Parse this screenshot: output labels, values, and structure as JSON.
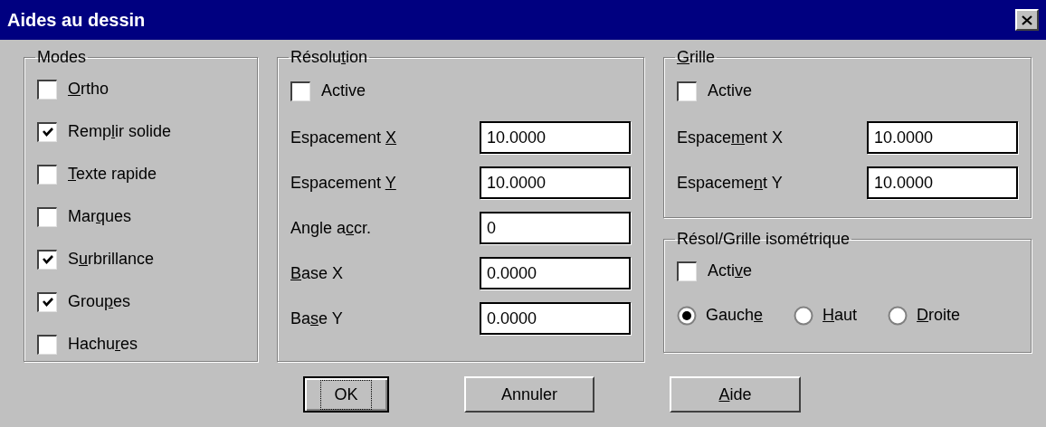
{
  "window": {
    "title": "Aides au dessin"
  },
  "groups": [
    {
      "kind": "checklist",
      "title": [
        {
          "text": "Modes"
        }
      ],
      "items": [
        {
          "label": [
            {
              "text": "O",
              "underlined": true
            },
            {
              "text": "rtho"
            }
          ],
          "checked": false
        },
        {
          "label": [
            {
              "text": "Remp"
            },
            {
              "text": "l",
              "underlined": true
            },
            {
              "text": "ir solide"
            }
          ],
          "checked": true
        },
        {
          "label": [
            {
              "text": "T",
              "underlined": true
            },
            {
              "text": "exte rapide"
            }
          ],
          "checked": false
        },
        {
          "label": [
            {
              "text": "Mar"
            },
            {
              "text": "q",
              "underlined": true
            },
            {
              "text": "ues"
            }
          ],
          "checked": false
        },
        {
          "label": [
            {
              "text": "S"
            },
            {
              "text": "u",
              "underlined": true
            },
            {
              "text": "rbrillance"
            }
          ],
          "checked": true
        },
        {
          "label": [
            {
              "text": "Grou"
            },
            {
              "text": "p",
              "underlined": true
            },
            {
              "text": "es"
            }
          ],
          "checked": true
        },
        {
          "label": [
            {
              "text": "Hachu"
            },
            {
              "text": "r",
              "underlined": true
            },
            {
              "text": "es"
            }
          ],
          "checked": false
        }
      ]
    },
    {
      "kind": "settings",
      "title": [
        {
          "text": "Résolu"
        },
        {
          "text": "t",
          "underlined": true
        },
        {
          "text": "ion"
        }
      ],
      "active": {
        "label": [
          {
            "text": "Active"
          }
        ],
        "checked": false
      },
      "fields": [
        {
          "label": [
            {
              "text": "Espacement "
            },
            {
              "text": "X",
              "underlined": true
            }
          ],
          "value": "10.0000"
        },
        {
          "label": [
            {
              "text": "Espacement "
            },
            {
              "text": "Y",
              "underlined": true
            }
          ],
          "value": "10.0000"
        },
        {
          "label": [
            {
              "text": "Angle a"
            },
            {
              "text": "c",
              "underlined": true
            },
            {
              "text": "cr."
            }
          ],
          "value": "0"
        },
        {
          "label": [
            {
              "text": "B",
              "underlined": true
            },
            {
              "text": "ase X"
            }
          ],
          "value": "0.0000"
        },
        {
          "label": [
            {
              "text": "Ba"
            },
            {
              "text": "s",
              "underlined": true
            },
            {
              "text": "e Y"
            }
          ],
          "value": "0.0000"
        }
      ]
    },
    {
      "kind": "settings",
      "title": [
        {
          "text": "G",
          "underlined": true
        },
        {
          "text": "rille"
        }
      ],
      "active": {
        "label": [
          {
            "text": "Active"
          }
        ],
        "checked": false
      },
      "fields": [
        {
          "label": [
            {
              "text": "Espace"
            },
            {
              "text": "m",
              "underlined": true
            },
            {
              "text": "ent X"
            }
          ],
          "value": "10.0000"
        },
        {
          "label": [
            {
              "text": "Espaceme"
            },
            {
              "text": "n",
              "underlined": true
            },
            {
              "text": "t Y"
            }
          ],
          "value": "10.0000"
        }
      ]
    },
    {
      "kind": "iso",
      "title": [
        {
          "text": "Résol/Grille isométrique"
        }
      ],
      "active": {
        "label": [
          {
            "text": "Acti"
          },
          {
            "text": "v",
            "underlined": true
          },
          {
            "text": "e"
          }
        ],
        "checked": false
      },
      "options": [
        {
          "label": [
            {
              "text": "Gauch"
            },
            {
              "text": "e",
              "underlined": true
            }
          ],
          "selected": true
        },
        {
          "label": [
            {
              "text": "H",
              "underlined": true
            },
            {
              "text": "aut"
            }
          ],
          "selected": false
        },
        {
          "label": [
            {
              "text": "D",
              "underlined": true
            },
            {
              "text": "roite"
            }
          ],
          "selected": false
        }
      ]
    }
  ],
  "buttons": [
    {
      "label": [
        {
          "text": "OK"
        }
      ],
      "default": true
    },
    {
      "label": [
        {
          "text": "Annuler"
        }
      ],
      "default": false
    },
    {
      "label": [
        {
          "text": "A",
          "underlined": true
        },
        {
          "text": "ide"
        }
      ],
      "default": false
    }
  ]
}
